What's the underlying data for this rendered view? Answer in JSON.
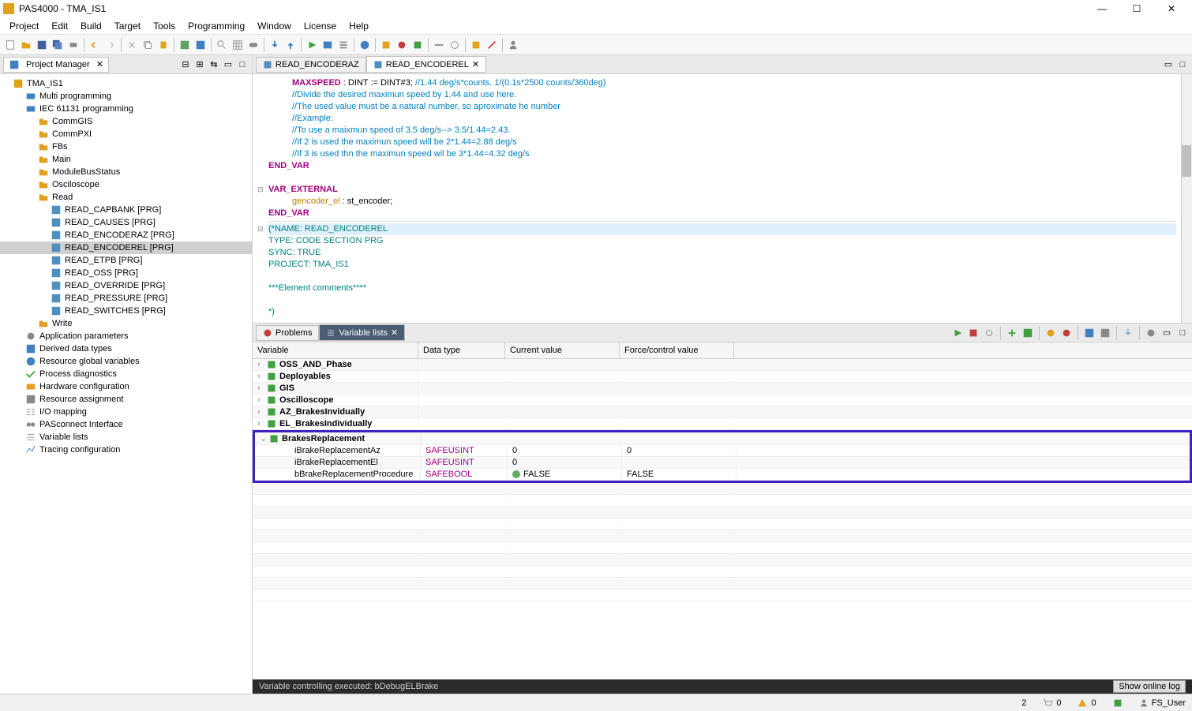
{
  "window": {
    "title": "PAS4000 - TMA_IS1"
  },
  "menubar": [
    "Project",
    "Edit",
    "Build",
    "Target",
    "Tools",
    "Programming",
    "Window",
    "License",
    "Help"
  ],
  "project_panel": {
    "title": "Project Manager",
    "close_x": "✕",
    "root": "TMA_IS1",
    "multi_prog": "Multi programming",
    "iec_prog": "IEC 61131 programming",
    "folders": {
      "commgis": "CommGIS",
      "commpxi": "CommPXI",
      "fbs": "FBs",
      "main": "Main",
      "modulebus": "ModuleBusStatus",
      "osciloscope": "Osciloscope",
      "read": "Read",
      "write": "Write"
    },
    "read_items": [
      "READ_CAPBANK [PRG]",
      "READ_CAUSES [PRG]",
      "READ_ENCODERAZ [PRG]",
      "READ_ENCODEREL [PRG]",
      "READ_ETPB [PRG]",
      "READ_OSS [PRG]",
      "READ_OVERRIDE [PRG]",
      "READ_PRESSURE [PRG]",
      "READ_SWITCHES [PRG]"
    ],
    "other": {
      "app_params": "Application parameters",
      "derived_types": "Derived data types",
      "res_globals": "Resource global variables",
      "proc_diag": "Process diagnostics",
      "hw_config": "Hardware configuration",
      "res_assign": "Resource assignment",
      "io_map": "I/O mapping",
      "pasconnect": "PASconnect Interface",
      "var_lists": "Variable lists",
      "tracing": "Tracing configuration"
    }
  },
  "editor": {
    "tabs": [
      {
        "label": "READ_ENCODERAZ"
      },
      {
        "label": "READ_ENCODEREL"
      }
    ]
  },
  "code": {
    "maxspeed": "MAXSPEED",
    "maxspeed_decl": "          : DINT := DINT#3;   ",
    "maxspeed_cmt": "//1.44 deg/s*counts. 1/(0.1s*2500 counts/360deg)",
    "c1": "//Divide the desired maximun speed by 1.44 and use here.",
    "c2": "//The used value must be a natural number, so aproximate he number",
    "c3": "//Example:",
    "c4": "//To use a maixmun speed of 3.5 deg/s--> 3.5/1.44=2.43.",
    "c5": "//If 2 is used the maximun speed will be 2*1.44=2.88 deg/s",
    "c6": "//If 3 is used thn the maximun speed wil be 3*1.44=4.32 deg/s",
    "end_var": "END_VAR",
    "var_ext": "VAR_EXTERNAL",
    "genc": "gencoder_el",
    "genc_decl": "     : st_encoder;",
    "meta_name": "(*NAME: READ_ENCODEREL",
    "meta_type": "TYPE: CODE SECTION PRG",
    "meta_sync": "SYNC: TRUE",
    "meta_proj": "PROJECT: TMA_IS1",
    "meta_elem": "***Element comments****",
    "meta_end": "*)"
  },
  "bottom_tabs": {
    "problems": "Problems",
    "var_lists": "Variable lists"
  },
  "var_table": {
    "headers": {
      "name": "Variable",
      "type": "Data type",
      "cur": "Current value",
      "force": "Force/control value"
    },
    "groups": [
      {
        "name": "OSS_AND_Phase"
      },
      {
        "name": "Deployables"
      },
      {
        "name": "GIS"
      },
      {
        "name": "Oscilloscope"
      },
      {
        "name": "AZ_BrakesInvidually"
      },
      {
        "name": "EL_BrakesIndividually"
      }
    ],
    "expanded": {
      "name": "BrakesReplacement",
      "rows": [
        {
          "name": "iBrakeReplacementAz",
          "type": "SAFEUSINT",
          "cur": "0",
          "force": "0"
        },
        {
          "name": "iBrakeReplacementEl",
          "type": "SAFEUSINT",
          "cur": "0",
          "force": ""
        },
        {
          "name": "bBrakeReplacementProcedure",
          "type": "SAFEBOOL",
          "cur": "FALSE",
          "force": "FALSE",
          "led": true
        }
      ]
    }
  },
  "status_line": {
    "msg": "Variable controlling executed: bDebugELBrake",
    "btn": "Show online log"
  },
  "statusbar": {
    "count1": "2",
    "cart": "0",
    "warn": "0",
    "user": "FS_User"
  }
}
